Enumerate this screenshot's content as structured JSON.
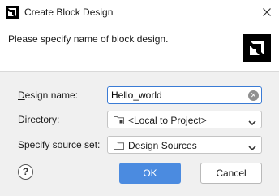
{
  "window": {
    "title": "Create Block Design",
    "app_icon": "amd-logo-icon",
    "close_icon": "close-icon"
  },
  "header": {
    "instruction": "Please specify name of block design.",
    "logo": "amd-logo-icon"
  },
  "form": {
    "design_name": {
      "label_mnemonic": "D",
      "label_rest": "esign name:",
      "value": "Hello_world",
      "clear_icon": "clear-icon"
    },
    "directory": {
      "label_mnemonic": "D",
      "label_rest": "irectory:",
      "value": "<Local to Project>",
      "icon": "folder-icon"
    },
    "source_set": {
      "label": "Specify source set:",
      "value": "Design Sources",
      "icon": "folder-icon"
    }
  },
  "buttons": {
    "help": "?",
    "ok": "OK",
    "cancel": "Cancel"
  },
  "colors": {
    "accent": "#4b8be0",
    "focus_border": "#3a7bd5",
    "content_bg": "#f0f0f0"
  }
}
